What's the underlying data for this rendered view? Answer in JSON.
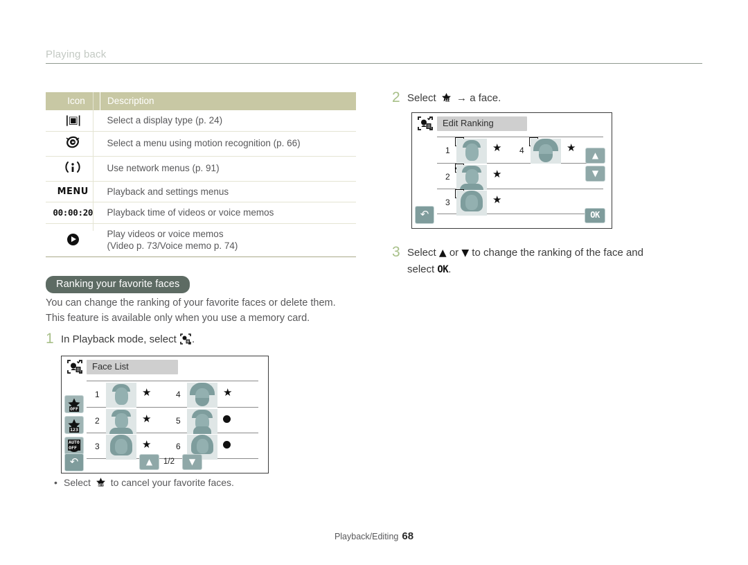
{
  "running_head": {
    "title": "Playing back"
  },
  "icon_table": {
    "headers": [
      "Icon",
      "Description"
    ],
    "rows": [
      {
        "icon": "display-type-icon",
        "icon_text": "",
        "desc": "Select a display type (p. 24)"
      },
      {
        "icon": "motion-recognition-icon",
        "icon_text": "",
        "desc": "Select a menu using motion recognition (p. 66)"
      },
      {
        "icon": "network-icon",
        "icon_text": "",
        "desc": "Use network menus (p. 91)"
      },
      {
        "icon": "menu-icon",
        "icon_text": "MENU",
        "desc": "Playback and settings menus"
      },
      {
        "icon": "playback-time-icon",
        "icon_text": "00:00:20",
        "desc": "Playback time of videos or voice memos"
      },
      {
        "icon": "play-icon",
        "icon_text": "",
        "desc": "Play videos or voice memos",
        "desc2": "(Video p. 73/Voice memo p. 74)"
      }
    ]
  },
  "section": {
    "heading": "Ranking your favorite faces",
    "intro_line1": "You can change the ranking of your favorite faces or delete them.",
    "intro_line2": "This feature is available only when you use a memory card."
  },
  "steps": {
    "step1": {
      "number": "1",
      "before": "In Playback mode, select",
      "icon": "face-list-icon",
      "after": "."
    },
    "step2": {
      "number": "2",
      "before": "Select",
      "icon": "favorite-star-icon",
      "arrow": "→",
      "after": "a face."
    },
    "step3": {
      "number": "3",
      "before": "Select",
      "up": "▲",
      "middle": "or",
      "down": "▼",
      "after": "to change the ranking of the face and",
      "line2_before": "select",
      "line2_ok": "OK",
      "line2_after": "."
    }
  },
  "face_list_screen": {
    "screen_name": "face-list-screen",
    "title": "Face List",
    "title_icon": "smart-face-recognition-icon",
    "page_indicator": "1/2",
    "side_buttons": [
      {
        "name": "favorite-off-button",
        "label": "OFF",
        "icon": "star-off-icon"
      },
      {
        "name": "favorite-rank-button",
        "label": "123",
        "icon": "star-rank-icon"
      },
      {
        "name": "auto-off-button",
        "label": "AUTO OFF",
        "icon": "auto-off-icon"
      },
      {
        "name": "back-button",
        "label": "↶",
        "icon": "back-arrow-icon"
      }
    ],
    "nav": {
      "up": "▲",
      "down": "▼"
    },
    "entries": [
      {
        "rank": "1",
        "mark": "star",
        "column": "left"
      },
      {
        "rank": "2",
        "mark": "star",
        "column": "left"
      },
      {
        "rank": "3",
        "mark": "star",
        "column": "left"
      },
      {
        "rank": "4",
        "mark": "star",
        "column": "right"
      },
      {
        "rank": "5",
        "mark": "dot",
        "column": "right"
      },
      {
        "rank": "6",
        "mark": "dot",
        "column": "right"
      }
    ]
  },
  "edit_ranking_screen": {
    "screen_name": "edit-ranking-screen",
    "title": "Edit Ranking",
    "title_icon": "smart-face-recognition-icon",
    "ok_label": "OK",
    "back_label": "↶",
    "nav": {
      "up": "▲",
      "down": "▼"
    },
    "entries": [
      {
        "rank": "1",
        "mark": "star",
        "checked": false,
        "column": "left"
      },
      {
        "rank": "2",
        "mark": "star",
        "checked": true,
        "column": "left"
      },
      {
        "rank": "3",
        "mark": "star",
        "checked": false,
        "column": "left"
      },
      {
        "rank": "4",
        "mark": "star",
        "checked": false,
        "column": "right"
      }
    ]
  },
  "note": {
    "bullet": "•",
    "before": "Select",
    "icon": "star-off-icon",
    "after": "to cancel your favorite faces."
  },
  "footer": {
    "label": "Playback/Editing",
    "page": "68"
  },
  "colors": {
    "table_header_bg": "#c8c8a4",
    "pill_bg": "#5d6b63",
    "step_number": "#a8c089",
    "lcd_button": "#8fa8a8",
    "thumb_bg": "#dfe6e6",
    "face_tone": "#93b0b0",
    "running_head": "#c3c9c3"
  }
}
